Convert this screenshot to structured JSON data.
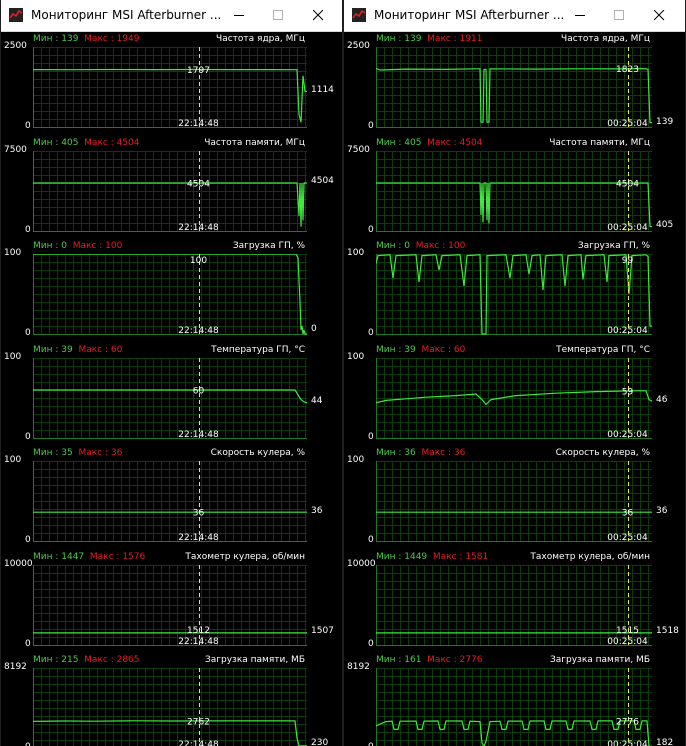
{
  "windows": [
    {
      "title": "Мониторинг MSI Afterburner ...",
      "graphs": [
        {
          "name": "Частота ядра, МГц",
          "min_label": "Мин : 139",
          "max_label": "Макс : 1949",
          "ymax": "2500",
          "ymin": "0",
          "range": [
            0,
            2500
          ],
          "marker_value": "1797",
          "marker_time": "22:14:48",
          "current": "1114",
          "series": [
            [
              0,
              1790
            ],
            [
              5,
              1795
            ],
            [
              40,
              1792
            ],
            [
              80,
              1797
            ],
            [
              120,
              1793
            ],
            [
              160,
              1797
            ],
            [
              200,
              1795
            ],
            [
              240,
              1793
            ],
            [
              262,
              1792
            ],
            [
              264,
              1790
            ],
            [
              266,
              400
            ],
            [
              268,
              150
            ],
            [
              270,
              1600
            ],
            [
              272,
              1114
            ],
            [
              274,
              1114
            ]
          ]
        },
        {
          "name": "Частота памяти, МГц",
          "min_label": "Мин : 405",
          "max_label": "Макс : 4504",
          "ymax": "7500",
          "ymin": "0",
          "range": [
            0,
            7500
          ],
          "marker_value": "4504",
          "marker_time": "22:14:48",
          "current": "4504",
          "series": [
            [
              0,
              4504
            ],
            [
              264,
              4504
            ],
            [
              266,
              1400
            ],
            [
              267,
              4504
            ],
            [
              268,
              400
            ],
            [
              269,
              4504
            ],
            [
              270,
              1000
            ],
            [
              271,
              4504
            ],
            [
              274,
              4504
            ]
          ]
        },
        {
          "name": "Загрузка ГП, %",
          "min_label": "Мин : 0",
          "max_label": "Макс : 100",
          "ymax": "100",
          "ymin": "0",
          "range": [
            0,
            100
          ],
          "marker_value": "100",
          "marker_time": "22:14:48",
          "current": "0",
          "series": [
            [
              0,
              100
            ],
            [
              263,
              100
            ],
            [
              265,
              95
            ],
            [
              267,
              40
            ],
            [
              268,
              5
            ],
            [
              269,
              10
            ],
            [
              270,
              0
            ],
            [
              271,
              5
            ],
            [
              272,
              0
            ],
            [
              274,
              0
            ]
          ]
        },
        {
          "name": "Температура ГП, °С",
          "min_label": "Мин : 39",
          "max_label": "Макс : 60",
          "ymax": "100",
          "ymin": "0",
          "range": [
            0,
            100
          ],
          "marker_value": "60",
          "marker_time": "22:14:48",
          "current": "44",
          "series": [
            [
              0,
              60
            ],
            [
              60,
              60
            ],
            [
              120,
              60
            ],
            [
              200,
              60
            ],
            [
              262,
              60
            ],
            [
              266,
              52
            ],
            [
              268,
              48
            ],
            [
              271,
              45
            ],
            [
              274,
              44
            ]
          ]
        },
        {
          "name": "Скорость кулера, %",
          "min_label": "Мин : 35",
          "max_label": "Макс : 36",
          "ymax": "100",
          "ymin": "0",
          "range": [
            0,
            100
          ],
          "marker_value": "36",
          "marker_time": "22:14:48",
          "current": "36",
          "series": [
            [
              0,
              36
            ],
            [
              274,
              36
            ]
          ]
        },
        {
          "name": "Тахометр кулера, об/мин",
          "min_label": "Мин : 1447",
          "max_label": "Макс : 1576",
          "ymax": "10000",
          "ymin": "0",
          "range": [
            0,
            10000
          ],
          "marker_value": "1512",
          "marker_time": "22:14:48",
          "current": "1507",
          "series": [
            [
              0,
              1510
            ],
            [
              274,
              1507
            ]
          ]
        },
        {
          "name": "Загрузка памяти, МБ",
          "min_label": "Мин : 215",
          "max_label": "Макс : 2865",
          "ymax": "8192",
          "ymin": "0",
          "range": [
            0,
            8192
          ],
          "marker_value": "2762",
          "marker_time": "22:14:48",
          "current": "230",
          "series": [
            [
              0,
              2720
            ],
            [
              30,
              2760
            ],
            [
              60,
              2740
            ],
            [
              100,
              2790
            ],
            [
              140,
              2760
            ],
            [
              180,
              2780
            ],
            [
              220,
              2770
            ],
            [
              262,
              2770
            ],
            [
              264,
              1000
            ],
            [
              266,
              230
            ],
            [
              274,
              230
            ]
          ]
        }
      ]
    },
    {
      "title": "Мониторинг MSI Afterburner ...",
      "graphs": [
        {
          "name": "Частота ядра, МГц",
          "min_label": "Мин : 139",
          "max_label": "Макс : 1911",
          "ymax": "2500",
          "ymin": "0",
          "range": [
            0,
            2500
          ],
          "marker_value": "1823",
          "marker_time": "00:25:04",
          "current": "139",
          "series": [
            [
              0,
              1830
            ],
            [
              4,
              1780
            ],
            [
              30,
              1810
            ],
            [
              70,
              1800
            ],
            [
              100,
              1820
            ],
            [
              104,
              1820
            ],
            [
              105,
              150
            ],
            [
              107,
              150
            ],
            [
              108,
              1800
            ],
            [
              110,
              1800
            ],
            [
              111,
              150
            ],
            [
              113,
              150
            ],
            [
              114,
              1820
            ],
            [
              160,
              1810
            ],
            [
              200,
              1820
            ],
            [
              240,
              1815
            ],
            [
              270,
              1823
            ],
            [
              272,
              1800
            ],
            [
              274,
              139
            ],
            [
              276,
              139
            ]
          ]
        },
        {
          "name": "Частота памяти, МГц",
          "min_label": "Мин : 405",
          "max_label": "Макс : 4504",
          "ymax": "7500",
          "ymin": "0",
          "range": [
            0,
            7500
          ],
          "marker_value": "4504",
          "marker_time": "00:25:04",
          "current": "405",
          "series": [
            [
              0,
              4504
            ],
            [
              104,
              4504
            ],
            [
              105,
              1500
            ],
            [
              106,
              4504
            ],
            [
              107,
              800
            ],
            [
              108,
              4504
            ],
            [
              110,
              4504
            ],
            [
              111,
              1000
            ],
            [
              112,
              4504
            ],
            [
              113,
              700
            ],
            [
              114,
              4504
            ],
            [
              272,
              4504
            ],
            [
              274,
              405
            ],
            [
              276,
              405
            ]
          ]
        },
        {
          "name": "Загрузка ГП, %",
          "min_label": "Мин : 0",
          "max_label": "Макс : 100",
          "ymax": "100",
          "ymin": "0",
          "range": [
            0,
            100
          ],
          "marker_value": "99",
          "marker_time": "00:25:04",
          "current": "",
          "series": [
            [
              0,
              88
            ],
            [
              2,
              98
            ],
            [
              14,
              99
            ],
            [
              17,
              70
            ],
            [
              20,
              98
            ],
            [
              40,
              99
            ],
            [
              43,
              65
            ],
            [
              46,
              98
            ],
            [
              60,
              99
            ],
            [
              63,
              80
            ],
            [
              66,
              98
            ],
            [
              84,
              99
            ],
            [
              88,
              60
            ],
            [
              91,
              98
            ],
            [
              104,
              99
            ],
            [
              106,
              0
            ],
            [
              110,
              0
            ],
            [
              111,
              98
            ],
            [
              130,
              99
            ],
            [
              134,
              70
            ],
            [
              137,
              98
            ],
            [
              150,
              99
            ],
            [
              153,
              75
            ],
            [
              156,
              98
            ],
            [
              164,
              99
            ],
            [
              167,
              55
            ],
            [
              170,
              98
            ],
            [
              186,
              99
            ],
            [
              189,
              60
            ],
            [
              192,
              98
            ],
            [
              205,
              99
            ],
            [
              207,
              68
            ],
            [
              210,
              98
            ],
            [
              228,
              99
            ],
            [
              231,
              65
            ],
            [
              233,
              98
            ],
            [
              250,
              99
            ],
            [
              253,
              50
            ],
            [
              256,
              98
            ],
            [
              270,
              99
            ],
            [
              272,
              97
            ],
            [
              274,
              10
            ],
            [
              276,
              10
            ]
          ]
        },
        {
          "name": "Температура ГП, °С",
          "min_label": "Мин : 39",
          "max_label": "Макс : 60",
          "ymax": "100",
          "ymin": "0",
          "range": [
            0,
            100
          ],
          "marker_value": "59",
          "marker_time": "00:25:04",
          "current": "46",
          "series": [
            [
              0,
              44
            ],
            [
              10,
              47
            ],
            [
              30,
              49
            ],
            [
              50,
              51
            ],
            [
              80,
              53
            ],
            [
              100,
              55
            ],
            [
              106,
              48
            ],
            [
              110,
              42
            ],
            [
              115,
              48
            ],
            [
              140,
              53
            ],
            [
              180,
              56
            ],
            [
              220,
              58
            ],
            [
              258,
              59
            ],
            [
              270,
              59
            ],
            [
              273,
              48
            ],
            [
              276,
              46
            ]
          ]
        },
        {
          "name": "Скорость кулера, %",
          "min_label": "Мин : 36",
          "max_label": "Макс : 36",
          "ymax": "100",
          "ymin": "0",
          "range": [
            0,
            100
          ],
          "marker_value": "36",
          "marker_time": "00:25:04",
          "current": "36",
          "series": [
            [
              0,
              36
            ],
            [
              276,
              36
            ]
          ]
        },
        {
          "name": "Тахометр кулера, об/мин",
          "min_label": "Мин : 1449",
          "max_label": "Макс : 1581",
          "ymax": "10000",
          "ymin": "0",
          "range": [
            0,
            10000
          ],
          "marker_value": "1515",
          "marker_time": "00:25:04",
          "current": "1518",
          "series": [
            [
              0,
              1515
            ],
            [
              276,
              1518
            ]
          ]
        },
        {
          "name": "Загрузка памяти, МБ",
          "min_label": "Мин : 161",
          "max_label": "Макс : 2776",
          "ymax": "8192",
          "ymin": "0",
          "range": [
            0,
            8192
          ],
          "marker_value": "2776",
          "marker_time": "00:25:04",
          "current": "182",
          "series": [
            [
              0,
              2250
            ],
            [
              4,
              2450
            ],
            [
              10,
              2700
            ],
            [
              16,
              2750
            ],
            [
              18,
              1900
            ],
            [
              22,
              1900
            ],
            [
              24,
              2740
            ],
            [
              40,
              2750
            ],
            [
              42,
              1900
            ],
            [
              46,
              1900
            ],
            [
              48,
              2750
            ],
            [
              62,
              2760
            ],
            [
              64,
              1900
            ],
            [
              68,
              1900
            ],
            [
              70,
              2760
            ],
            [
              86,
              2760
            ],
            [
              88,
              1900
            ],
            [
              92,
              1900
            ],
            [
              94,
              2750
            ],
            [
              104,
              2700
            ],
            [
              106,
              500
            ],
            [
              108,
              161
            ],
            [
              110,
              700
            ],
            [
              114,
              2700
            ],
            [
              124,
              2740
            ],
            [
              126,
              1900
            ],
            [
              130,
              1900
            ],
            [
              132,
              2750
            ],
            [
              146,
              2750
            ],
            [
              148,
              1900
            ],
            [
              152,
              1900
            ],
            [
              154,
              2760
            ],
            [
              168,
              2760
            ],
            [
              170,
              1900
            ],
            [
              174,
              1900
            ],
            [
              176,
              2760
            ],
            [
              190,
              2760
            ],
            [
              192,
              1900
            ],
            [
              196,
              1900
            ],
            [
              198,
              2760
            ],
            [
              214,
              2760
            ],
            [
              216,
              1900
            ],
            [
              220,
              1900
            ],
            [
              222,
              2770
            ],
            [
              236,
              2770
            ],
            [
              238,
              1900
            ],
            [
              242,
              1900
            ],
            [
              244,
              2770
            ],
            [
              258,
              2776
            ],
            [
              260,
              1900
            ],
            [
              264,
              1900
            ],
            [
              266,
              2776
            ],
            [
              271,
              2776
            ],
            [
              273,
              182
            ],
            [
              276,
              182
            ]
          ]
        }
      ]
    }
  ]
}
